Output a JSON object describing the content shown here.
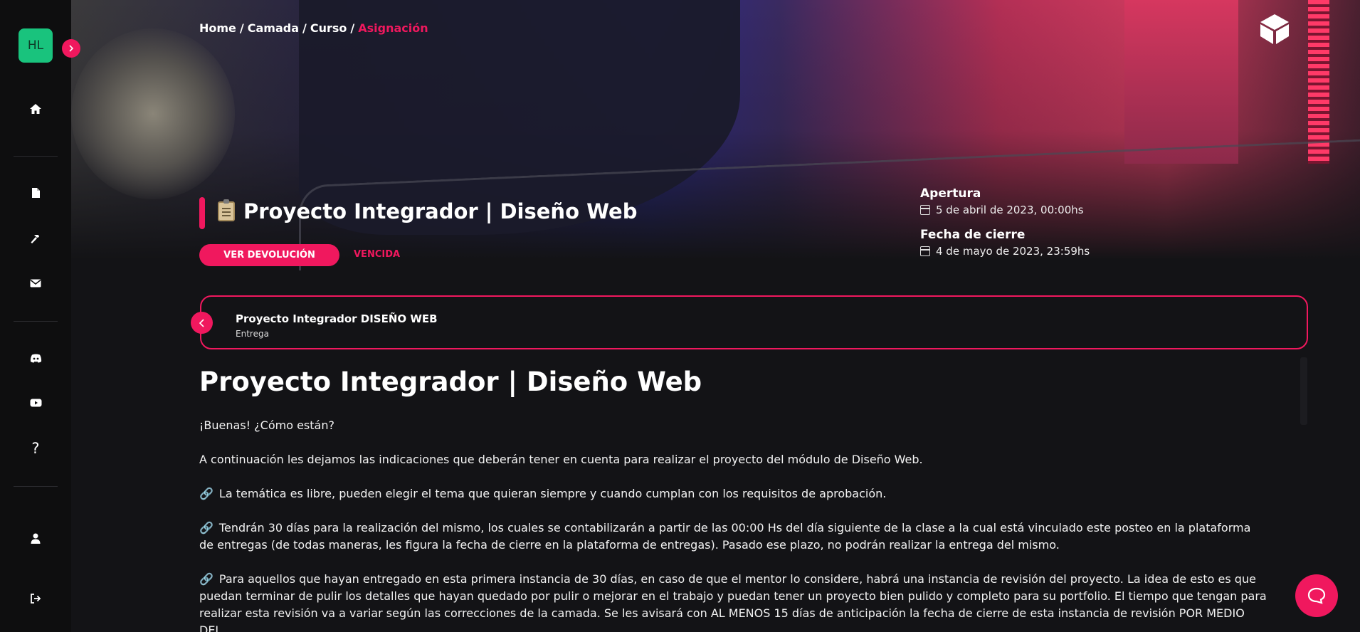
{
  "sidebar": {
    "avatar_initials": "HL",
    "items": [
      {
        "icon": "home-icon"
      },
      {
        "icon": "document-icon"
      },
      {
        "icon": "hammer-icon"
      },
      {
        "icon": "mail-icon"
      },
      {
        "icon": "discord-icon"
      },
      {
        "icon": "youtube-icon"
      },
      {
        "icon": "help-icon",
        "glyph": "?"
      },
      {
        "icon": "user-icon"
      },
      {
        "icon": "logout-icon"
      }
    ]
  },
  "breadcrumb": {
    "home": "Home",
    "sep": "/",
    "camada": "Camada",
    "curso": "Curso",
    "current": "Asignación"
  },
  "header": {
    "title": "Proyecto Integrador | Diseño Web",
    "feedback_button": "VER DEVOLUCIÓN",
    "status": "VENCIDA",
    "opening_label": "Apertura",
    "opening_date": "5 de abril de 2023, 00:00hs",
    "closing_label": "Fecha de cierre",
    "closing_date": "4 de mayo de 2023, 23:59hs"
  },
  "card": {
    "title": "Proyecto Integrador DISEÑO WEB",
    "subtitle": "Entrega"
  },
  "content": {
    "heading": "Proyecto Integrador | Diseño Web",
    "greeting": "¡Buenas! ¿Cómo están?",
    "intro": "A continuación les dejamos las indicaciones que deberán tener en cuenta para realizar el proyecto del módulo de Diseño Web.",
    "point1": "La temática es libre, pueden elegir el tema que quieran siempre y cuando cumplan con los requisitos de aprobación.",
    "point2": "Tendrán 30 días para la realización del mismo, los cuales se contabilizarán a partir de las 00:00 Hs del día siguiente de la clase a la cual está vinculado este posteo en la plataforma de entregas (de todas maneras, les figura la fecha de cierre en la plataforma de entregas). Pasado ese plazo, no podrán realizar la entrega del mismo.",
    "point3": "Para aquellos que hayan entregado en esta primera instancia de 30 días, en caso de que el mentor lo considere, habrá una instancia de revisión del proyecto. La idea de esto es que puedan terminar de pulir los detalles que hayan quedado por pulir o mejorar en el trabajo y puedan tener un proyecto bien pulido y completo para su portfolio. El tiempo que tengan para realizar esta revisión va a variar según las correcciones de la camada. Se les avisará con AL MENOS 15 días de anticipación la fecha de cierre de esta instancia de revisión POR MEDIO DEL"
  },
  "colors": {
    "accent": "#f0185e",
    "avatar_bg": "#19c37d",
    "background": "#131316",
    "sidebar": "#0e0e0f"
  }
}
